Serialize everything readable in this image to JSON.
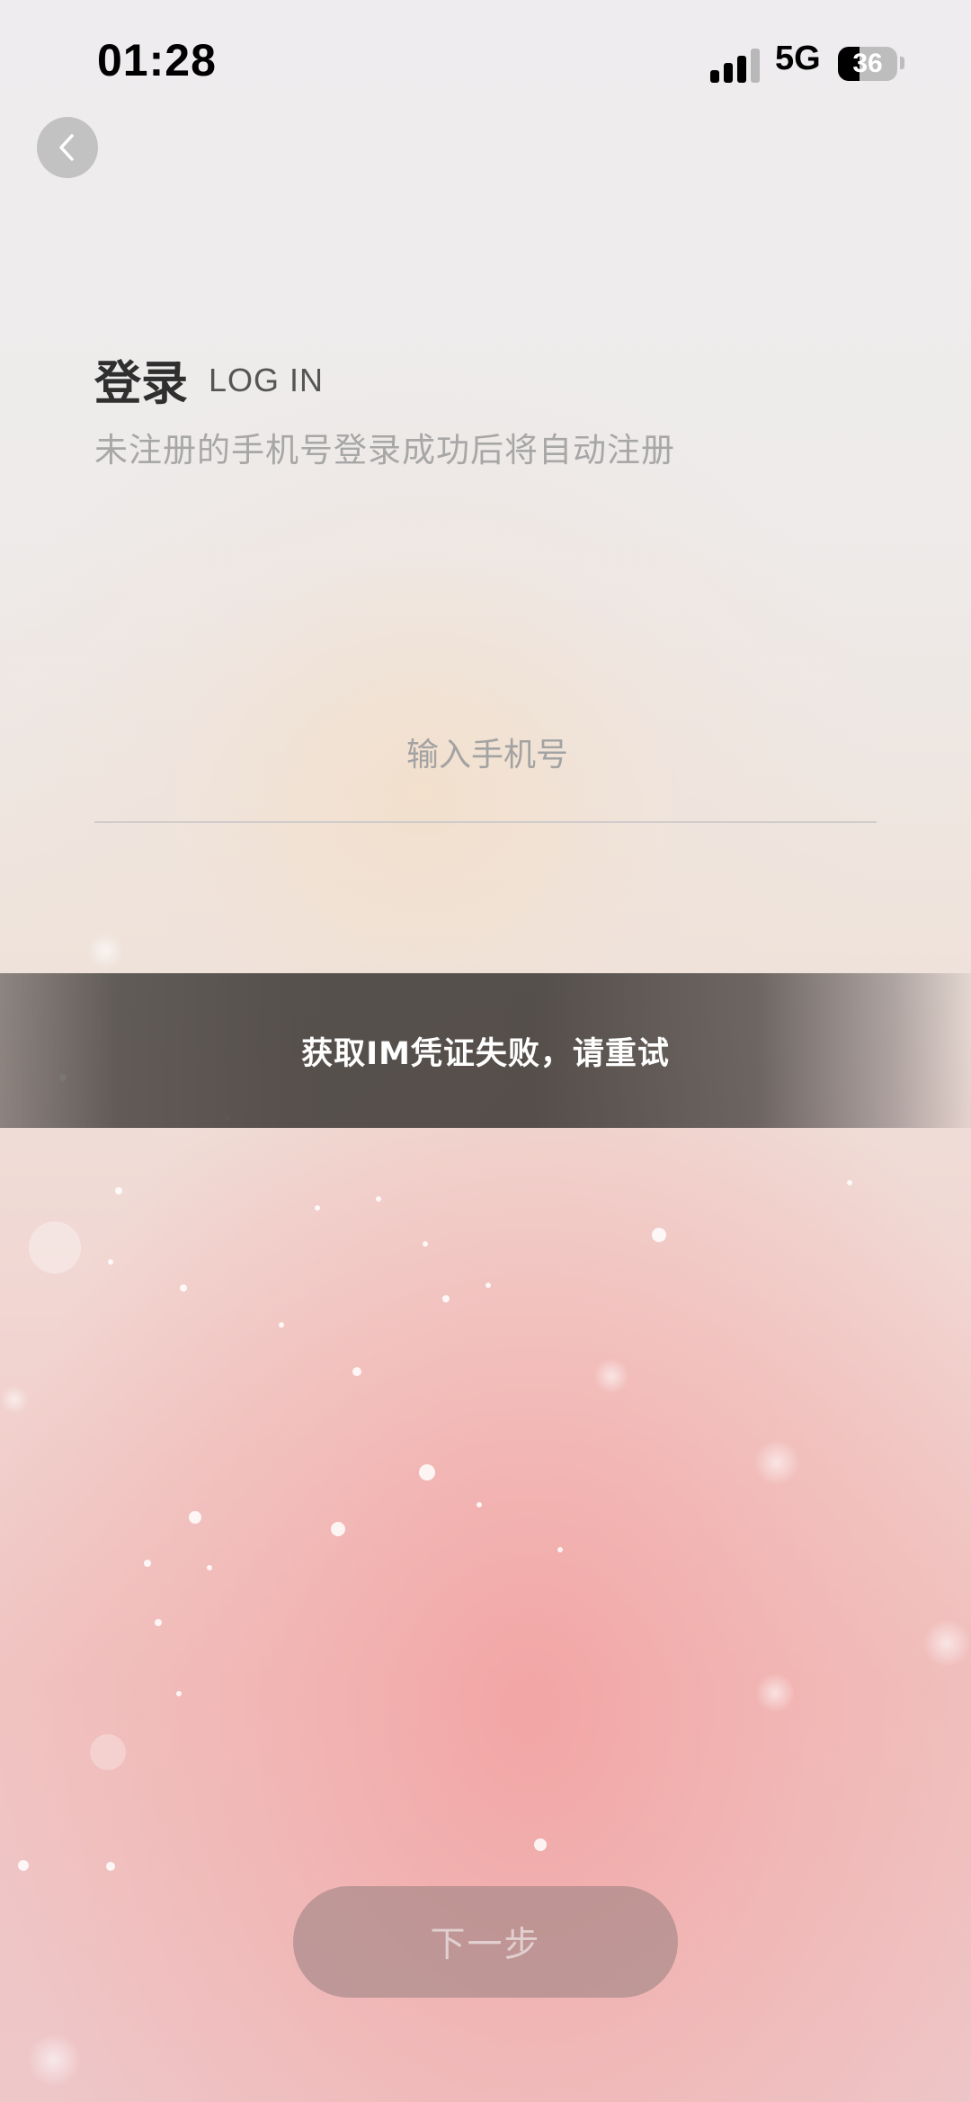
{
  "status_bar": {
    "time": "01:28",
    "network": "5G",
    "battery": "36",
    "battery_level": 0.36,
    "signal_bars_active": 3,
    "signal_bars_total": 4
  },
  "icons": {
    "back": "chevron-left-icon",
    "signal": "cellular-signal-icon",
    "battery": "battery-icon"
  },
  "header": {
    "title": "登录",
    "subtitle": "LOG IN",
    "hint": "未注册的手机号登录成功后将自动注册"
  },
  "form": {
    "phone_value": "",
    "phone_placeholder": "输入手机号"
  },
  "toast": {
    "message": "获取IM凭证失败，请重试"
  },
  "footer": {
    "next_label": "下一步"
  },
  "colors": {
    "title": "#2f2f2f",
    "hint": "#a7a7a7",
    "toast_bg": "#48433f",
    "next_button_bg": "#967e7e"
  }
}
